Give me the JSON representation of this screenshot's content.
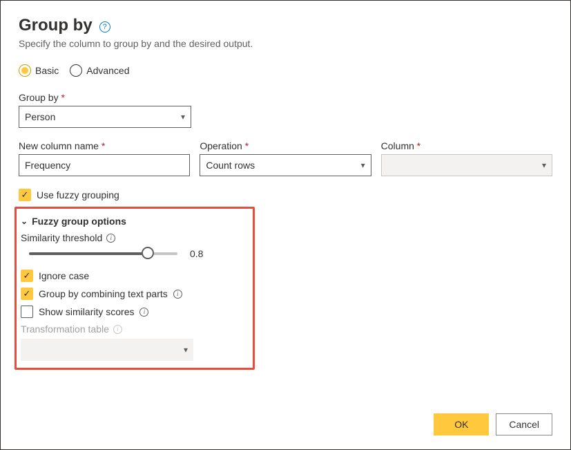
{
  "title": "Group by",
  "subtitle": "Specify the column to group by and the desired output.",
  "mode": {
    "basic": "Basic",
    "advanced": "Advanced",
    "selected": "basic"
  },
  "group_by": {
    "label": "Group by",
    "value": "Person"
  },
  "new_column": {
    "label": "New column name",
    "value": "Frequency"
  },
  "operation": {
    "label": "Operation",
    "value": "Count rows"
  },
  "column": {
    "label": "Column",
    "value": ""
  },
  "fuzzy": {
    "use_label": "Use fuzzy grouping",
    "use_checked": true,
    "section_title": "Fuzzy group options",
    "similarity_label": "Similarity threshold",
    "similarity_value": "0.8",
    "ignore_case": {
      "label": "Ignore case",
      "checked": true
    },
    "combine_parts": {
      "label": "Group by combining text parts",
      "checked": true
    },
    "show_scores": {
      "label": "Show similarity scores",
      "checked": false
    },
    "transform_table_label": "Transformation table"
  },
  "buttons": {
    "ok": "OK",
    "cancel": "Cancel"
  }
}
